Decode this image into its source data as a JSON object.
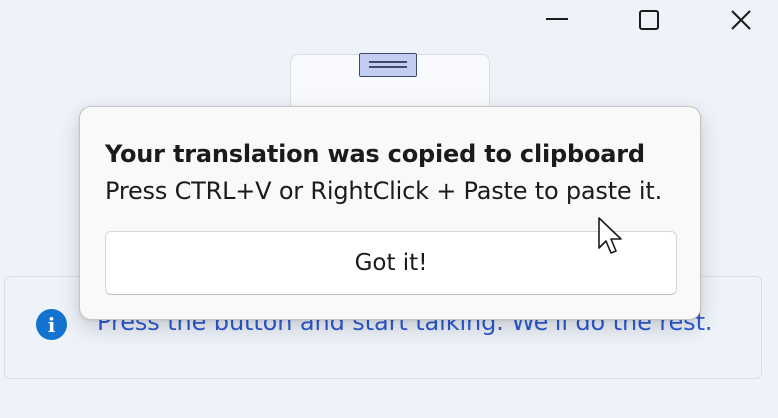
{
  "window_controls": {
    "minimize_icon": "minimize-icon",
    "maximize_icon": "maximize-icon",
    "close_icon": "close-icon"
  },
  "clipboard_icon": "clipboard-icon",
  "info_bar": {
    "icon": "info-icon",
    "icon_glyph": "i",
    "message": "Press the button and start talking. We'll do the rest.",
    "accent_color": "#2c5bd3",
    "icon_color": "#1273d0"
  },
  "teaching_tip": {
    "title": "Your translation was copied to clipboard",
    "subtitle": "Press CTRL+V or RightClick + Paste to paste it.",
    "button_label": "Got it!"
  }
}
